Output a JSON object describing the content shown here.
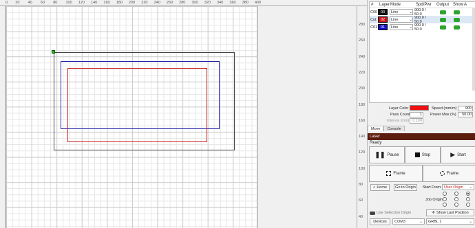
{
  "ruler": {
    "x_ticks": [
      "0",
      "20",
      "40",
      "60",
      "80",
      "100",
      "120",
      "140",
      "160",
      "180",
      "200",
      "220",
      "240",
      "260",
      "280",
      "300",
      "320",
      "340",
      "360",
      "380",
      "400"
    ],
    "y_ticks": [
      "280",
      "260",
      "240",
      "220",
      "200",
      "180",
      "160",
      "140",
      "120",
      "100",
      "80",
      "60",
      "40"
    ]
  },
  "cuts": {
    "headers": [
      "#",
      "Layer",
      "Mode",
      "Spd/Pwr",
      "Output",
      "Show",
      "A"
    ],
    "rows": [
      {
        "id": "C00",
        "layer": "00",
        "color": "#111111",
        "mode": "Line",
        "spdpwr": "900.0 / 50.0"
      },
      {
        "id": "Cut",
        "layer": "02",
        "color": "#cc1111",
        "mode": "Line",
        "spdpwr": "900.0 / 50.0"
      },
      {
        "id": "C01",
        "layer": "01",
        "color": "#1111cc",
        "mode": "Line",
        "spdpwr": "900.0 / 50.0"
      }
    ]
  },
  "props": {
    "layer_color_label": "Layer Color",
    "pass_count_label": "Pass Count",
    "pass_count": "1",
    "interval_label": "Interval (mm)",
    "interval": "0.100",
    "speed_label": "Speed (mm/m)",
    "speed": "900",
    "power_label": "Power Max (%)",
    "power": "50.00"
  },
  "tabs": [
    "Move",
    "Console"
  ],
  "laser": {
    "title": "Laser",
    "status": "Ready",
    "pause": "Pause",
    "stop": "Stop",
    "start": "Start",
    "frame1": "Frame",
    "frame2": "Frame",
    "home": "Home",
    "goto_origin": "Go to Origin",
    "start_from_label": "Start From:",
    "start_from": "User Origin",
    "job_origin_label": "Job Origin",
    "use_selection_origin": "Use Selection Origin",
    "show_last_position": "Show Last Position",
    "devices": "Devices",
    "port": "COM3",
    "controller": "GRBL 1"
  },
  "colors": {
    "laser_title": "#5b1d0e",
    "layer_color": "#ee1111",
    "accent_green": "#2ea32e"
  }
}
